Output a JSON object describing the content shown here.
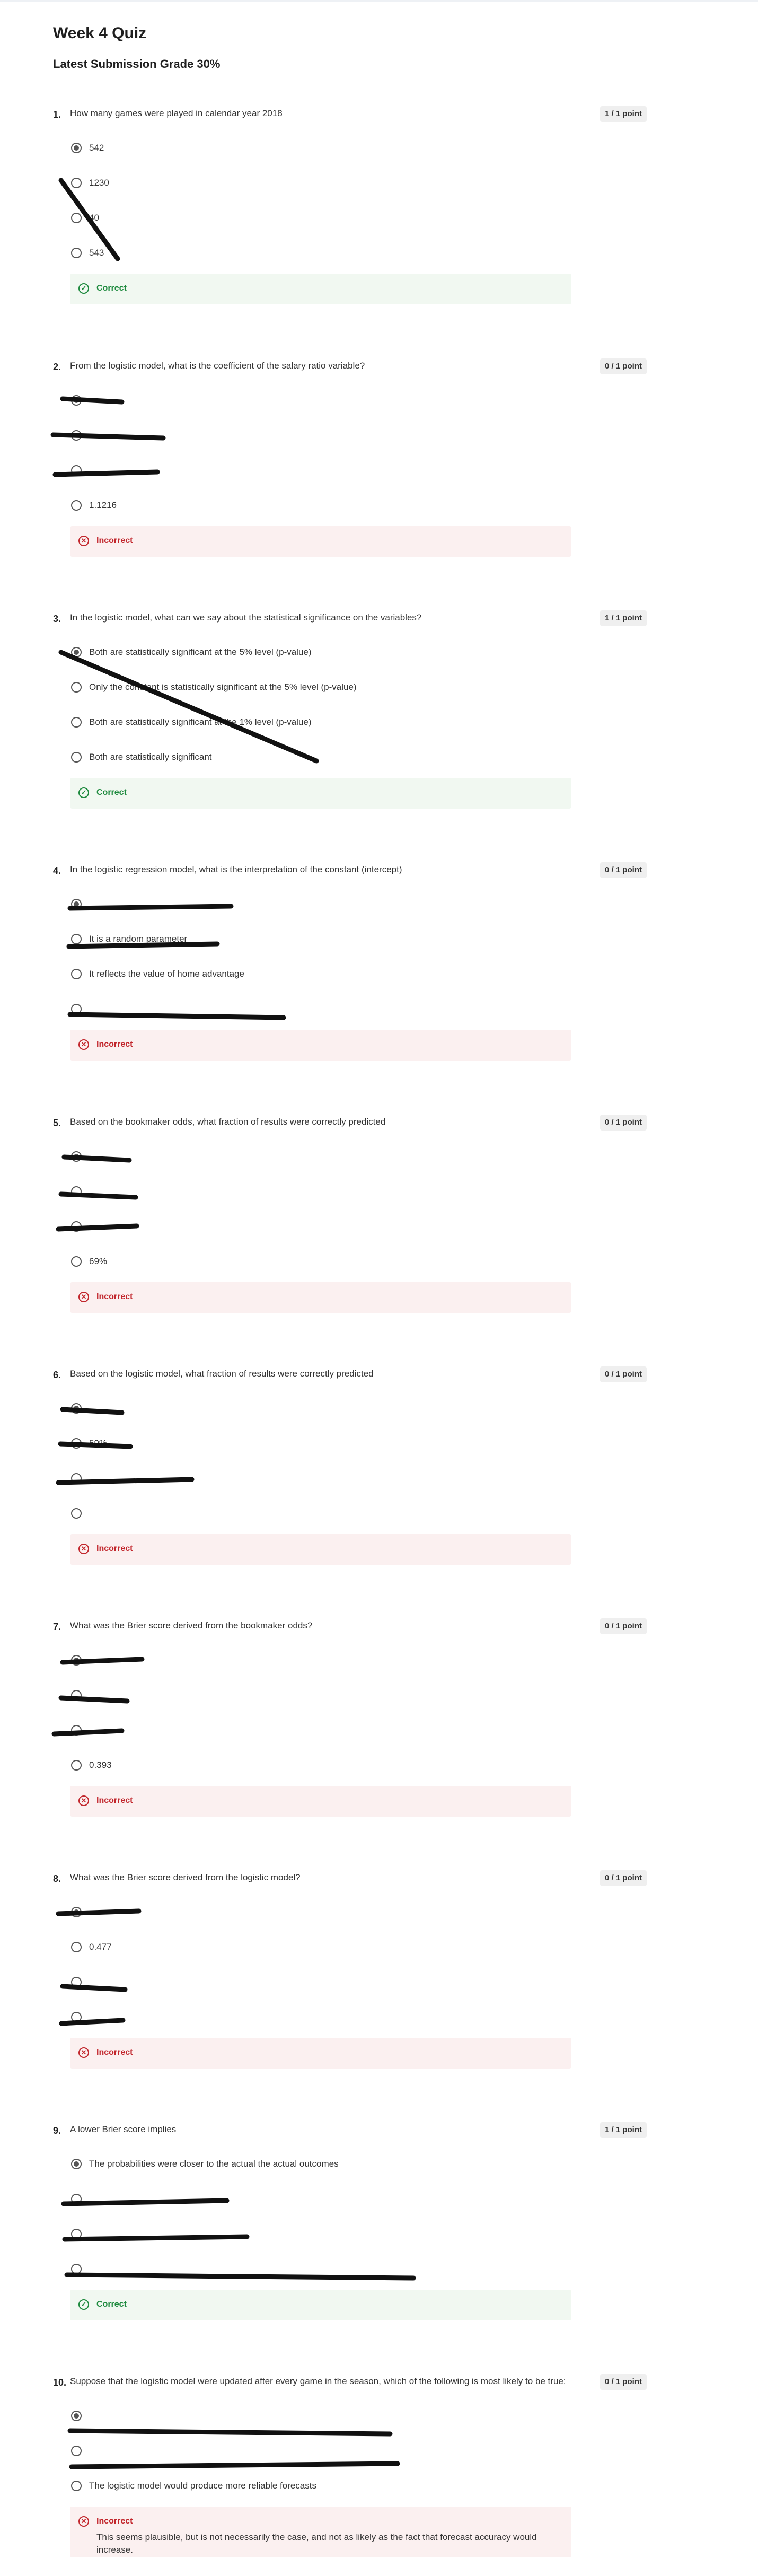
{
  "page": {
    "title": "Week 4 Quiz",
    "grade": "Latest Submission Grade 30%"
  },
  "questions": [
    {
      "number": "1.",
      "text": "How many games were played in calendar year 2018",
      "points": "1 / 1 point",
      "options": [
        "542",
        "1230",
        "40",
        "543"
      ],
      "selected": 0,
      "feedback": {
        "status": "correct",
        "label": "Correct",
        "explanation": ""
      }
    },
    {
      "number": "2.",
      "text": "From the logistic model, what is the coefficient of the salary ratio variable?",
      "points": "0 / 1 point",
      "options": [
        "",
        "",
        "",
        "1.1216"
      ],
      "selected": 0,
      "feedback": {
        "status": "incorrect",
        "label": "Incorrect",
        "explanation": ""
      }
    },
    {
      "number": "3.",
      "text": "In the logistic model, what can we say about the statistical significance on the variables?",
      "points": "1 / 1 point",
      "options": [
        "Both are statistically significant at the 5% level (p-value)",
        "Only the constant is statistically significant at the 5% level (p-value)",
        "Both are statistically significant at the 1% level (p-value)",
        "Both are statistically significant"
      ],
      "selected": 0,
      "feedback": {
        "status": "correct",
        "label": "Correct",
        "explanation": ""
      }
    },
    {
      "number": "4.",
      "text": "In the logistic regression model, what is the interpretation of the constant (intercept)",
      "points": "0 / 1 point",
      "options": [
        "",
        "It is a random parameter",
        "It reflects the value of home advantage",
        ""
      ],
      "selected": 0,
      "feedback": {
        "status": "incorrect",
        "label": "Incorrect",
        "explanation": ""
      }
    },
    {
      "number": "5.",
      "text": "Based on the bookmaker odds, what fraction of results were correctly predicted",
      "points": "0 / 1 point",
      "options": [
        "",
        "",
        "",
        "69%"
      ],
      "selected": 0,
      "feedback": {
        "status": "incorrect",
        "label": "Incorrect",
        "explanation": ""
      }
    },
    {
      "number": "6.",
      "text": "Based on the logistic model, what fraction of results were correctly predicted",
      "points": "0 / 1 point",
      "options": [
        "",
        "59%",
        "",
        ""
      ],
      "selected": 0,
      "feedback": {
        "status": "incorrect",
        "label": "Incorrect",
        "explanation": ""
      }
    },
    {
      "number": "7.",
      "text": "What was the Brier score derived from the bookmaker odds?",
      "points": "0 / 1 point",
      "options": [
        "",
        "",
        "",
        "0.393"
      ],
      "selected": 0,
      "feedback": {
        "status": "incorrect",
        "label": "Incorrect",
        "explanation": ""
      }
    },
    {
      "number": "8.",
      "text": "What was the Brier score derived from the logistic model?",
      "points": "0 / 1 point",
      "options": [
        "",
        "0.477",
        "",
        ""
      ],
      "selected": 0,
      "feedback": {
        "status": "incorrect",
        "label": "Incorrect",
        "explanation": ""
      }
    },
    {
      "number": "9.",
      "text": "A lower Brier score implies",
      "points": "1 / 1 point",
      "options": [
        "The probabilities were closer to the actual the actual outcomes",
        "",
        "",
        ""
      ],
      "selected": 0,
      "feedback": {
        "status": "correct",
        "label": "Correct",
        "explanation": ""
      }
    },
    {
      "number": "10.",
      "text": "Suppose that the logistic model were updated after every game in the season, which of the following is most likely to be true:",
      "points": "0 / 1 point",
      "options": [
        "",
        "",
        "The logistic model would produce more reliable forecasts"
      ],
      "selected": 0,
      "feedback": {
        "status": "incorrect",
        "label": "Incorrect",
        "explanation": "This seems plausible, but is not necessarily the case, and not as likely as the fact that forecast accuracy would increase."
      }
    }
  ]
}
